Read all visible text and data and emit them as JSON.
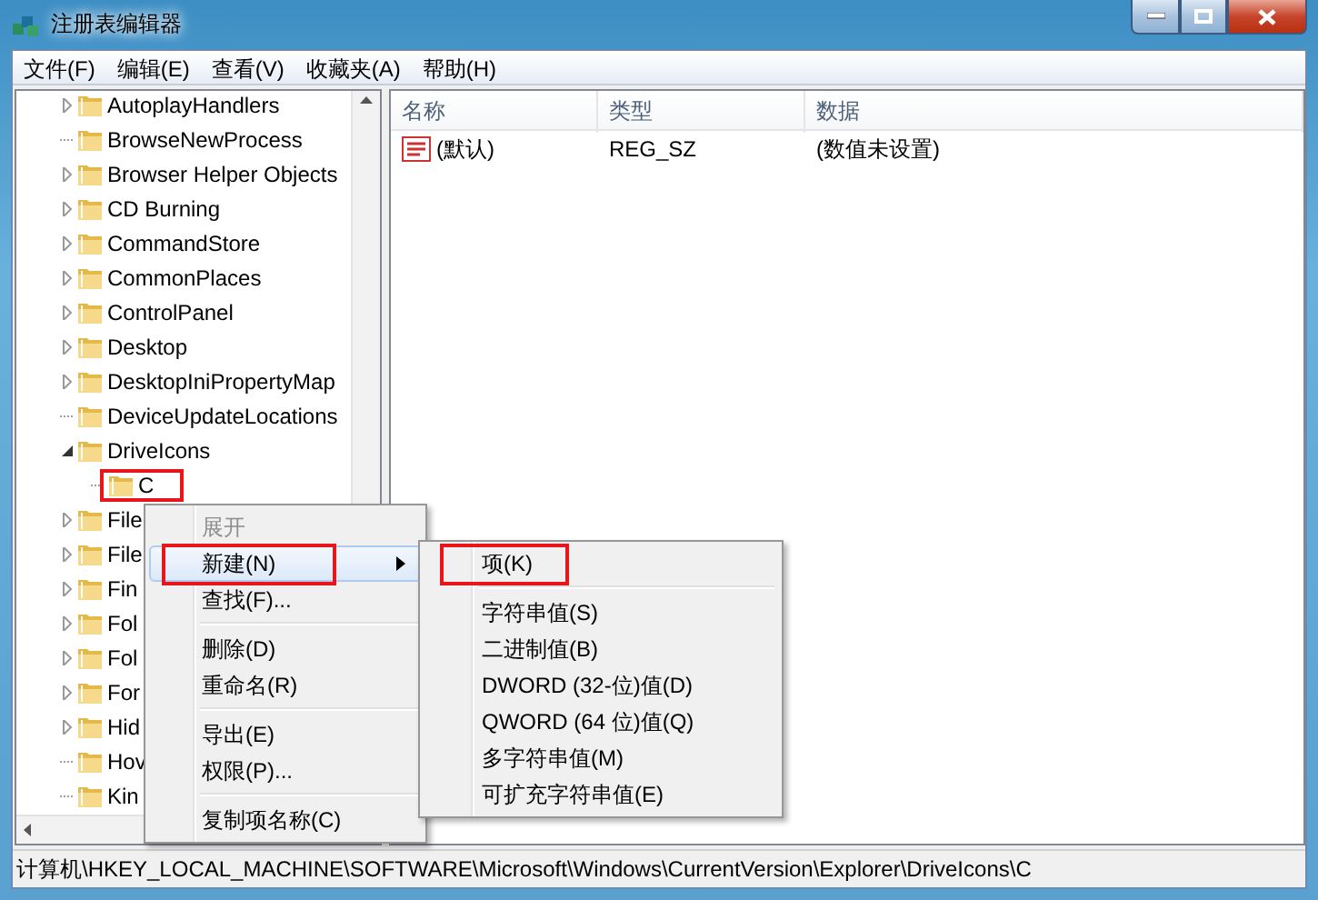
{
  "window": {
    "title": "注册表编辑器"
  },
  "menu_bar": [
    "文件(F)",
    "编辑(E)",
    "查看(V)",
    "收藏夹(A)",
    "帮助(H)"
  ],
  "tree": {
    "items": [
      {
        "kind": "branch",
        "label": "AutoplayHandlers",
        "expanded": false
      },
      {
        "kind": "leaf",
        "label": "BrowseNewProcess"
      },
      {
        "kind": "branch",
        "label": "Browser Helper Objects",
        "expanded": false
      },
      {
        "kind": "branch",
        "label": "CD Burning",
        "expanded": false
      },
      {
        "kind": "branch",
        "label": "CommandStore",
        "expanded": false
      },
      {
        "kind": "branch",
        "label": "CommonPlaces",
        "expanded": false
      },
      {
        "kind": "branch",
        "label": "ControlPanel",
        "expanded": false
      },
      {
        "kind": "branch",
        "label": "Desktop",
        "expanded": false
      },
      {
        "kind": "branch",
        "label": "DesktopIniPropertyMap",
        "expanded": false
      },
      {
        "kind": "leaf",
        "label": "DeviceUpdateLocations"
      },
      {
        "kind": "branch",
        "label": "DriveIcons",
        "expanded": true,
        "children": [
          {
            "kind": "leaf",
            "label": "C",
            "highlighted": true
          }
        ]
      },
      {
        "kind": "branch",
        "label": "File",
        "expanded": false
      },
      {
        "kind": "branch",
        "label": "File",
        "expanded": false
      },
      {
        "kind": "branch",
        "label": "Fin",
        "expanded": false
      },
      {
        "kind": "branch",
        "label": "Fol",
        "expanded": false
      },
      {
        "kind": "branch",
        "label": "Fol",
        "expanded": false
      },
      {
        "kind": "branch",
        "label": "For",
        "expanded": false
      },
      {
        "kind": "branch",
        "label": "Hid",
        "expanded": false
      },
      {
        "kind": "leaf",
        "label": "Hov"
      },
      {
        "kind": "leaf",
        "label": "Kin"
      }
    ]
  },
  "values_list": {
    "columns": [
      "名称",
      "类型",
      "数据"
    ],
    "rows": [
      {
        "name": "(默认)",
        "type": "REG_SZ",
        "data": "(数值未设置)"
      }
    ]
  },
  "context_menu": {
    "items": [
      {
        "kind": "item",
        "label": "展开",
        "disabled": true,
        "selected": false,
        "has_submenu": false,
        "highlighted": false
      },
      {
        "kind": "item",
        "label": "新建(N)",
        "disabled": false,
        "selected": true,
        "has_submenu": true,
        "highlighted": true
      },
      {
        "kind": "item",
        "label": "查找(F)...",
        "disabled": false,
        "selected": false,
        "has_submenu": false,
        "highlighted": false
      },
      {
        "kind": "separator"
      },
      {
        "kind": "item",
        "label": "删除(D)",
        "disabled": false,
        "selected": false,
        "has_submenu": false,
        "highlighted": false
      },
      {
        "kind": "item",
        "label": "重命名(R)",
        "disabled": false,
        "selected": false,
        "has_submenu": false,
        "highlighted": false
      },
      {
        "kind": "separator"
      },
      {
        "kind": "item",
        "label": "导出(E)",
        "disabled": false,
        "selected": false,
        "has_submenu": false,
        "highlighted": false
      },
      {
        "kind": "item",
        "label": "权限(P)...",
        "disabled": false,
        "selected": false,
        "has_submenu": false,
        "highlighted": false
      },
      {
        "kind": "separator"
      },
      {
        "kind": "item",
        "label": "复制项名称(C)",
        "disabled": false,
        "selected": false,
        "has_submenu": false,
        "highlighted": false
      }
    ]
  },
  "submenu": {
    "items": [
      {
        "kind": "item",
        "label": "项(K)",
        "disabled": false,
        "selected": false,
        "has_submenu": false,
        "highlighted": true
      },
      {
        "kind": "separator"
      },
      {
        "kind": "item",
        "label": "字符串值(S)",
        "disabled": false,
        "selected": false,
        "has_submenu": false,
        "highlighted": false
      },
      {
        "kind": "item",
        "label": "二进制值(B)",
        "disabled": false,
        "selected": false,
        "has_submenu": false,
        "highlighted": false
      },
      {
        "kind": "item",
        "label": "DWORD (32-位)值(D)",
        "disabled": false,
        "selected": false,
        "has_submenu": false,
        "highlighted": false
      },
      {
        "kind": "item",
        "label": "QWORD (64 位)值(Q)",
        "disabled": false,
        "selected": false,
        "has_submenu": false,
        "highlighted": false
      },
      {
        "kind": "item",
        "label": "多字符串值(M)",
        "disabled": false,
        "selected": false,
        "has_submenu": false,
        "highlighted": false
      },
      {
        "kind": "item",
        "label": "可扩充字符串值(E)",
        "disabled": false,
        "selected": false,
        "has_submenu": false,
        "highlighted": false
      }
    ]
  },
  "status_bar": {
    "path": "计算机\\HKEY_LOCAL_MACHINE\\SOFTWARE\\Microsoft\\Windows\\CurrentVersion\\Explorer\\DriveIcons\\C"
  }
}
